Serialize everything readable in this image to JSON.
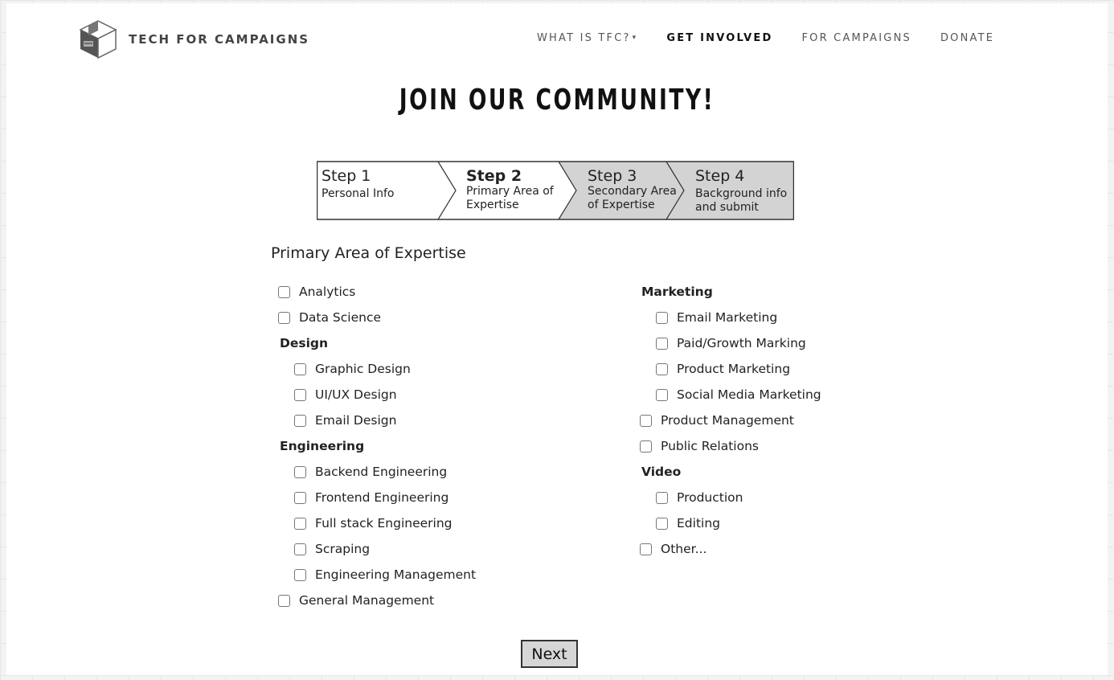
{
  "header": {
    "brand": "TECH FOR CAMPAIGNS",
    "nav": [
      {
        "label": "WHAT IS TFC?",
        "has_caret": true
      },
      {
        "label": "GET INVOLVED",
        "active": true
      },
      {
        "label": "FOR CAMPAIGNS"
      },
      {
        "label": "DONATE"
      }
    ],
    "caret": "▾"
  },
  "page_title": "JOIN OUR COMMUNITY!",
  "stepper": {
    "steps": [
      {
        "num": "Step 1",
        "label_line1": "Personal Info",
        "label_line2": "",
        "state": "done"
      },
      {
        "num": "Step 2",
        "label_line1": "Primary Area of",
        "label_line2": "Expertise",
        "state": "current"
      },
      {
        "num": "Step 3",
        "label_line1": "Secondary Area",
        "label_line2": "of Expertise",
        "state": "upcoming"
      },
      {
        "num": "Step 4",
        "label_line1": "Background info",
        "label_line2": "and submit",
        "state": "upcoming"
      }
    ]
  },
  "form": {
    "section_title": "Primary Area of Expertise",
    "left_column": [
      {
        "type": "option",
        "label": "Analytics"
      },
      {
        "type": "option",
        "label": "Data Science"
      },
      {
        "type": "group",
        "label": "Design"
      },
      {
        "type": "sub",
        "label": "Graphic Design"
      },
      {
        "type": "sub",
        "label": "UI/UX Design"
      },
      {
        "type": "sub",
        "label": "Email Design"
      },
      {
        "type": "group",
        "label": "Engineering"
      },
      {
        "type": "sub",
        "label": "Backend Engineering"
      },
      {
        "type": "sub",
        "label": "Frontend Engineering"
      },
      {
        "type": "sub",
        "label": "Full stack Engineering"
      },
      {
        "type": "sub",
        "label": "Scraping"
      },
      {
        "type": "sub",
        "label": "Engineering Management"
      },
      {
        "type": "option",
        "label": "General Management"
      }
    ],
    "right_column": [
      {
        "type": "group",
        "label": "Marketing"
      },
      {
        "type": "sub",
        "label": "Email Marketing"
      },
      {
        "type": "sub",
        "label": "Paid/Growth Marking"
      },
      {
        "type": "sub",
        "label": "Product Marketing"
      },
      {
        "type": "sub",
        "label": "Social Media Marketing"
      },
      {
        "type": "option",
        "label": "Product Management"
      },
      {
        "type": "option",
        "label": "Public Relations"
      },
      {
        "type": "group",
        "label": "Video"
      },
      {
        "type": "sub",
        "label": "Production"
      },
      {
        "type": "sub",
        "label": "Editing"
      },
      {
        "type": "option",
        "label": "Other..."
      }
    ],
    "next_label": "Next"
  },
  "colors": {
    "done_step": "#ffffff",
    "upcoming_step": "#d3d3d3",
    "border": "#333333"
  }
}
